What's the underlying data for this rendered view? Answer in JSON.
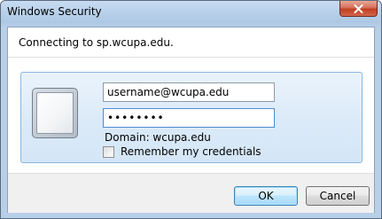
{
  "window": {
    "title": "Windows Security",
    "close_glyph": "✕"
  },
  "dialog": {
    "connecting_text": "Connecting to sp.wcupa.edu."
  },
  "credentials": {
    "username_value": "username@wcupa.edu",
    "password_value": "••••••••",
    "domain_text": "Domain: wcupa.edu",
    "remember_label": "Remember my credentials",
    "remember_checked": false,
    "avatar_icon": "user-tile-icon"
  },
  "buttons": {
    "ok_label": "OK",
    "cancel_label": "Cancel"
  },
  "colors": {
    "titlebar": "#b9d1ea",
    "close_button": "#c13f23",
    "tile_background": "#dbeaf8",
    "tile_border": "#86b6e0",
    "focus_border": "#4f8bcf"
  }
}
